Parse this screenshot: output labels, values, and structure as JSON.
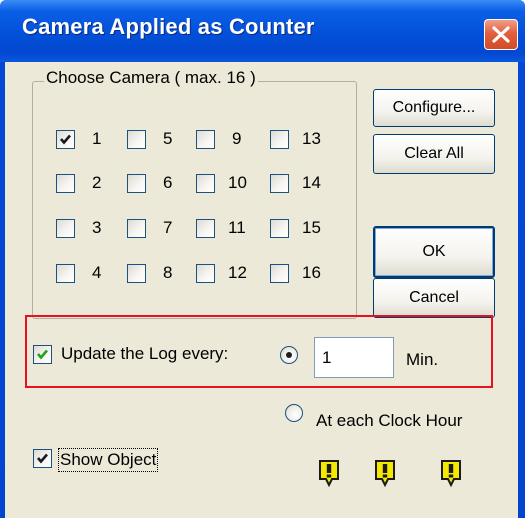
{
  "window": {
    "title": "Camera Applied as Counter"
  },
  "camera_group": {
    "legend": "Choose Camera ( max. 16 )",
    "cameras": [
      {
        "label": "1",
        "checked": true
      },
      {
        "label": "5",
        "checked": false
      },
      {
        "label": "9",
        "checked": false
      },
      {
        "label": "13",
        "checked": false
      },
      {
        "label": "2",
        "checked": false
      },
      {
        "label": "6",
        "checked": false
      },
      {
        "label": "10",
        "checked": false
      },
      {
        "label": "14",
        "checked": false
      },
      {
        "label": "3",
        "checked": false
      },
      {
        "label": "7",
        "checked": false
      },
      {
        "label": "11",
        "checked": false
      },
      {
        "label": "15",
        "checked": false
      },
      {
        "label": "4",
        "checked": false
      },
      {
        "label": "8",
        "checked": false
      },
      {
        "label": "12",
        "checked": false
      },
      {
        "label": "16",
        "checked": false
      }
    ]
  },
  "buttons": {
    "configure": "Configure...",
    "clear_all": "Clear All",
    "ok": "OK",
    "cancel": "Cancel"
  },
  "update_log": {
    "checkbox_label": "Update the Log every:",
    "checked": true,
    "interval_value": "1",
    "unit": "Min.",
    "interval_radio_selected": true,
    "clock_hour_label": "At each Clock Hour",
    "clock_hour_radio_selected": false
  },
  "show_object": {
    "label": "Show Object",
    "checked": true
  },
  "status_icons": [
    "warning-icon",
    "warning-icon",
    "warning-icon"
  ],
  "colors": {
    "title_bar": "#0348d0",
    "highlight_box": "#e8121f",
    "warning_icon_fill": "#f5e800",
    "dialog_background": "#ece9d8"
  }
}
